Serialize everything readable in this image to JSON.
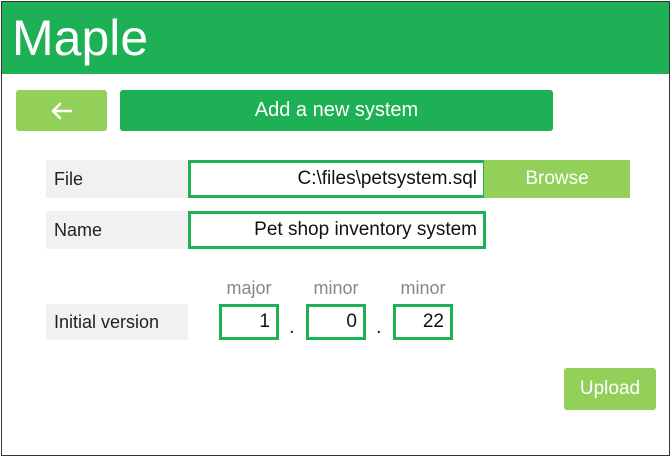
{
  "app": {
    "title": "Maple"
  },
  "nav": {
    "back_icon": "arrow-left-icon",
    "page_title": "Add a new system"
  },
  "form": {
    "file": {
      "label": "File",
      "value": "C:\\files\\petsystem.sql",
      "browse_label": "Browse"
    },
    "name": {
      "label": "Name",
      "value": "Pet shop inventory system"
    },
    "version": {
      "label": "Initial version",
      "headers": [
        "major",
        "minor",
        "minor"
      ],
      "values": [
        "1",
        "0",
        "22"
      ],
      "separator": "."
    }
  },
  "actions": {
    "upload_label": "Upload"
  },
  "colors": {
    "primary": "#1db054",
    "secondary": "#92d05a"
  }
}
